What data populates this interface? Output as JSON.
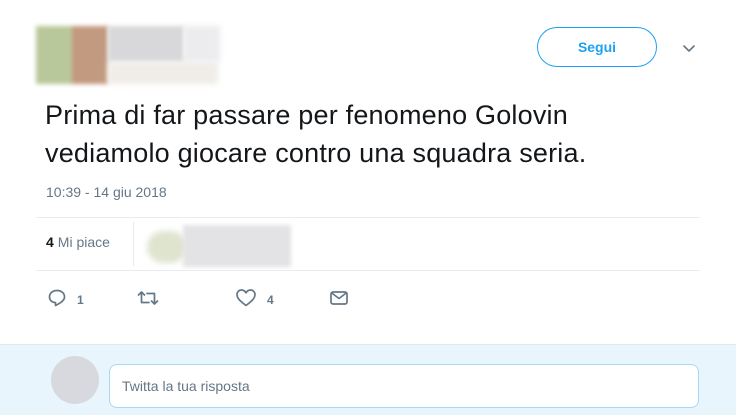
{
  "tweet": {
    "follow_label": "Segui",
    "text_line1": "Prima di far passare per fenomeno Golovin",
    "text_line2": "vediamolo giocare contro una squadra seria.",
    "timestamp": "10:39 - 14 giu 2018",
    "likes": {
      "count": "4",
      "label": "Mi piace"
    },
    "actions": {
      "reply_count": "1",
      "retweet_count": "",
      "like_count": "4"
    }
  },
  "reply": {
    "placeholder": "Twitta la tua risposta"
  },
  "colors": {
    "accent": "#1da1f2",
    "muted": "#657786",
    "reply_background": "#e8f5fd"
  },
  "icons": [
    "chevron-down-icon",
    "reply-icon",
    "retweet-icon",
    "heart-icon",
    "direct-message-icon"
  ]
}
